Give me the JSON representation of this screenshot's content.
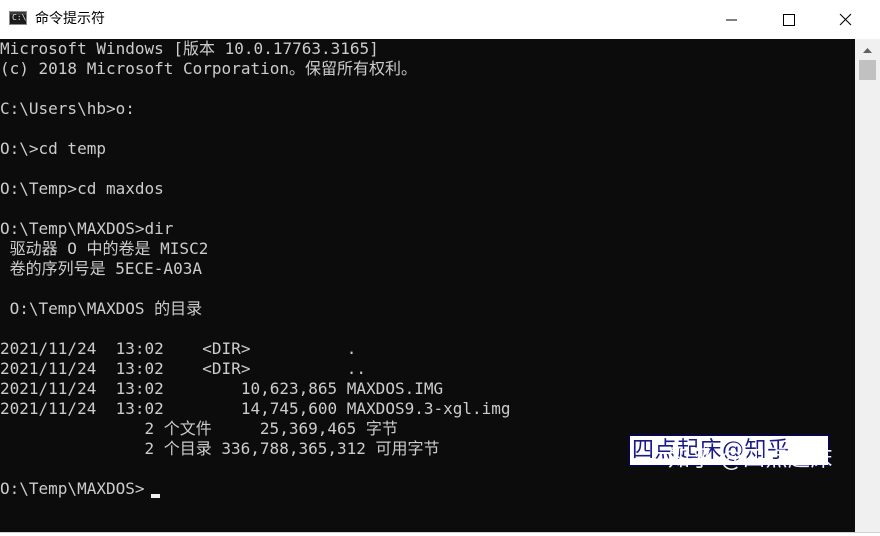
{
  "window": {
    "title": "命令提示符",
    "icon": "cmd-icon",
    "icon_text": "C:\\",
    "controls": [
      "minimize-icon",
      "maximize-icon",
      "close-icon"
    ]
  },
  "console": {
    "background": "#0c0c0c",
    "foreground": "#cccccc",
    "lines": [
      "Microsoft Windows [版本 10.0.17763.3165]",
      "(c) 2018 Microsoft Corporation。保留所有权利。",
      "",
      "C:\\Users\\hb>o:",
      "",
      "O:\\>cd temp",
      "",
      "O:\\Temp>cd maxdos",
      "",
      "O:\\Temp\\MAXDOS>dir",
      " 驱动器 O 中的卷是 MISC2",
      " 卷的序列号是 5ECE-A03A",
      "",
      " O:\\Temp\\MAXDOS 的目录",
      "",
      "2021/11/24  13:02    <DIR>          .",
      "2021/11/24  13:02    <DIR>          ..",
      "2021/11/24  13:02        10,623,865 MAXDOS.IMG",
      "2021/11/24  13:02        14,745,600 MAXDOS9.3-xgl.img",
      "               2 个文件     25,369,465 字节",
      "               2 个目录 336,788,365,312 可用字节",
      "",
      "O:\\Temp\\MAXDOS>"
    ]
  },
  "overlay_badge": "四点起床@知乎",
  "watermark": "知乎 @四点起床"
}
